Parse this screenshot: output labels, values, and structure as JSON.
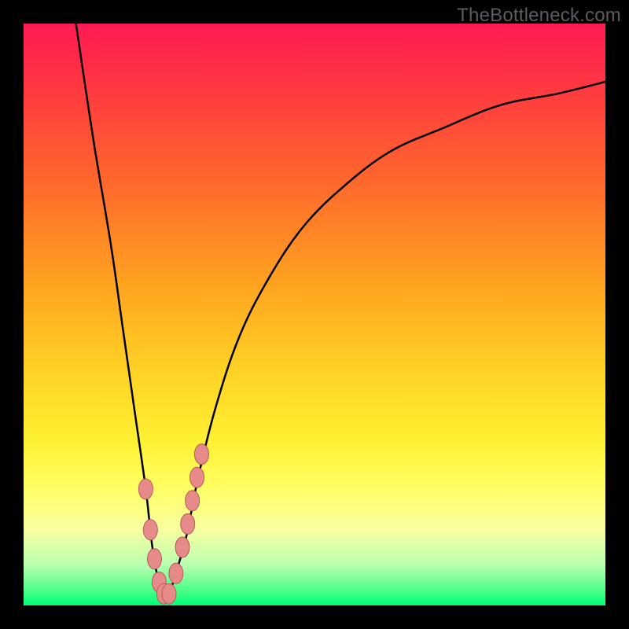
{
  "watermark": "TheBottleneck.com",
  "colors": {
    "frame": "#000000",
    "curve_stroke": "#000000",
    "marker_fill": "#e68a8a",
    "marker_stroke": "#b85a5a",
    "gradient_top": "#ff1a54",
    "gradient_bottom": "#00ff77"
  },
  "chart_data": {
    "type": "line",
    "title": "",
    "xlabel": "",
    "ylabel": "",
    "xlim": [
      0,
      100
    ],
    "ylim": [
      0,
      100
    ],
    "grid": false,
    "legend_position": "none",
    "series": [
      {
        "name": "bottleneck-curve",
        "x": [
          9,
          12,
          15,
          17,
          19,
          21,
          22,
          23,
          24,
          25,
          26,
          28,
          30,
          33,
          37,
          42,
          48,
          55,
          63,
          72,
          82,
          92,
          100
        ],
        "values": [
          100,
          80,
          62,
          48,
          34,
          20,
          11,
          5,
          2,
          2,
          5,
          12,
          22,
          34,
          46,
          56,
          65,
          72,
          78,
          82,
          86,
          88,
          90
        ]
      }
    ],
    "markers": {
      "name": "highlighted-points",
      "x": [
        21.0,
        21.8,
        22.5,
        23.3,
        24.1,
        25.0,
        26.2,
        27.3,
        28.2,
        29.0,
        29.8,
        30.6
      ],
      "values": [
        20.0,
        13.0,
        8.0,
        4.0,
        2.0,
        2.0,
        5.5,
        10.0,
        14.0,
        18.0,
        22.0,
        26.0
      ]
    }
  }
}
